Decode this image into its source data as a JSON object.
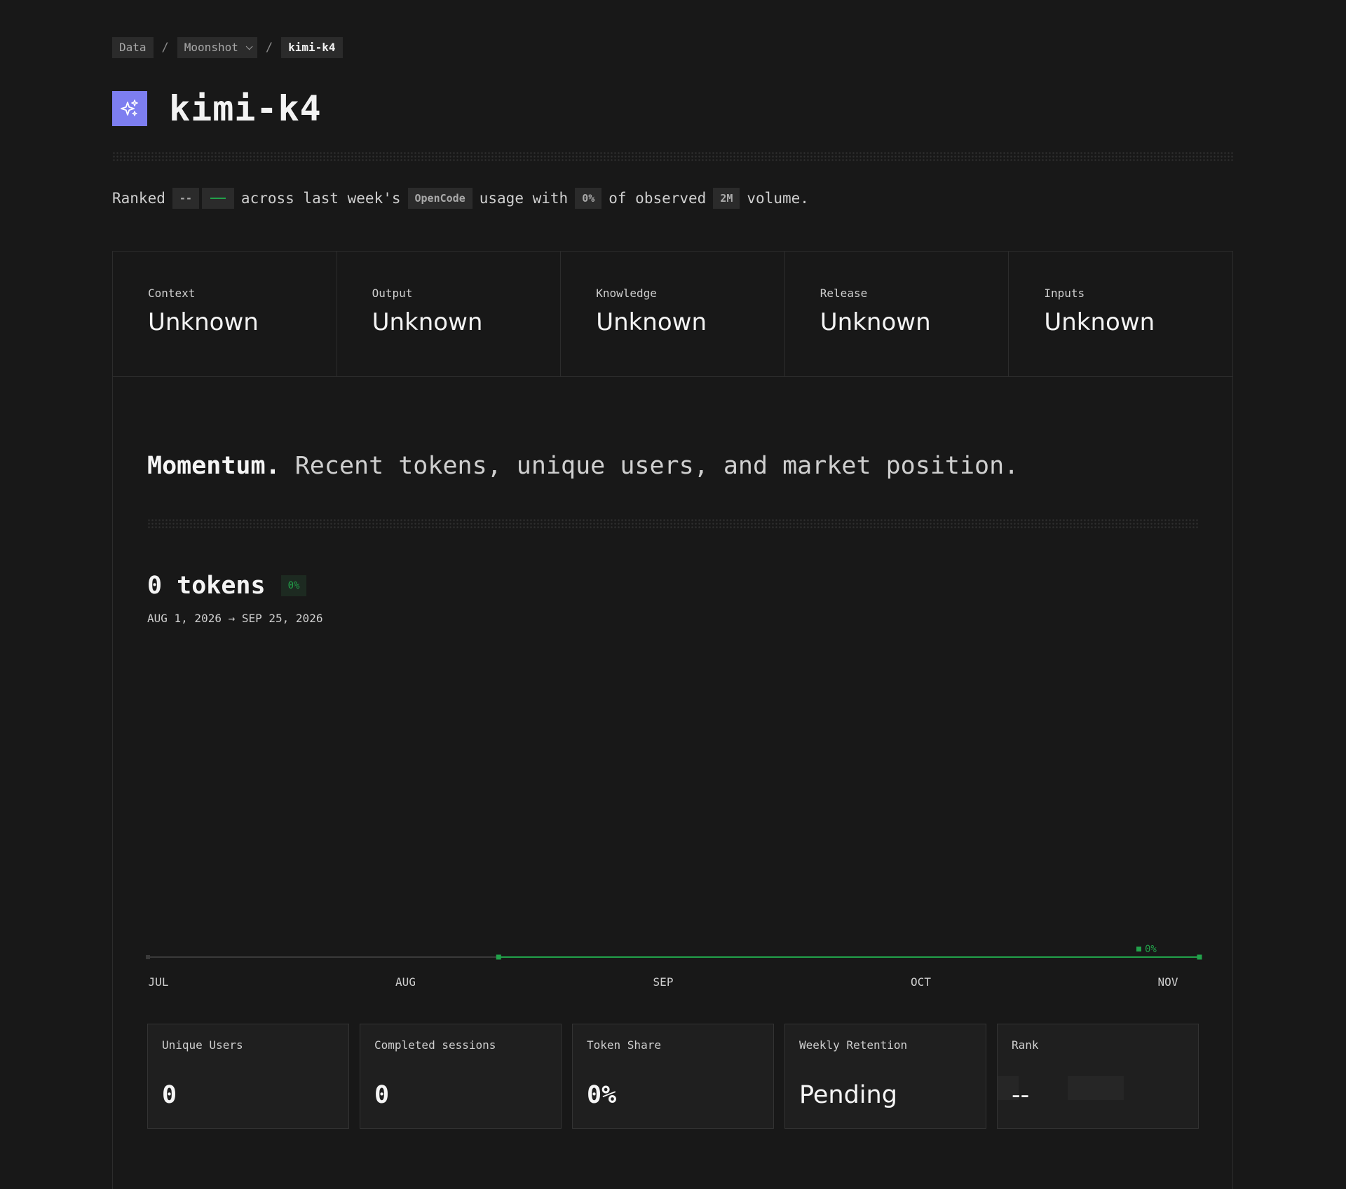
{
  "breadcrumb": {
    "root": "Data",
    "provider": "Moonshot",
    "model": "kimi-k4",
    "separator": "/"
  },
  "page_title": "kimi-k4",
  "summary": {
    "ranked": "Ranked",
    "rank_chip": "--",
    "across": "across last week's",
    "app_chip": "OpenCode",
    "usage": "usage with",
    "share_chip": "0%",
    "observed": "of observed",
    "volume_chip": "2M",
    "volume": "volume."
  },
  "stats": [
    {
      "label": "Context",
      "value": "Unknown"
    },
    {
      "label": "Output",
      "value": "Unknown"
    },
    {
      "label": "Knowledge",
      "value": "Unknown"
    },
    {
      "label": "Release",
      "value": "Unknown"
    },
    {
      "label": "Inputs",
      "value": "Unknown"
    }
  ],
  "momentum": {
    "heading": "Momentum.",
    "subheading": "Recent tokens, unique users, and market position."
  },
  "tokens": {
    "value": "0 tokens",
    "change": "0%",
    "range": "AUG 1, 2026 → SEP 25, 2026"
  },
  "colors": {
    "accent": "#22a14a",
    "logo": "#7d7ef0",
    "background": "#181818"
  },
  "chart_data": {
    "type": "line",
    "x": [
      "JUL",
      "AUG",
      "SEP",
      "OCT",
      "NOV"
    ],
    "series": [
      {
        "values": [
          0,
          0,
          0,
          0,
          0
        ]
      }
    ],
    "end_label": "0%",
    "highlight_from": "SEP"
  },
  "cards": [
    {
      "label": "Unique Users",
      "value": "0"
    },
    {
      "label": "Completed sessions",
      "value": "0"
    },
    {
      "label": "Token Share",
      "value": "0%"
    },
    {
      "label": "Weekly Retention",
      "value": "Pending"
    },
    {
      "label": "Rank",
      "value": "--"
    }
  ]
}
